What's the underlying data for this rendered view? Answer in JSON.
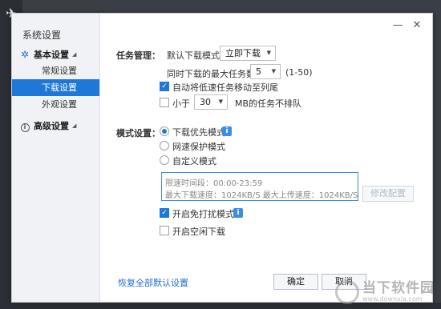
{
  "sidebar": {
    "title": "系统设置",
    "groups": [
      {
        "label": "基本设置",
        "icon": "gear-icon"
      },
      {
        "label": "高级设置",
        "icon": "info-circle-icon"
      }
    ],
    "items": [
      {
        "label": "常规设置",
        "active": false
      },
      {
        "label": "下载设置",
        "active": true
      },
      {
        "label": "外观设置",
        "active": false
      }
    ]
  },
  "window": {
    "minimize": "—",
    "close": "✕"
  },
  "task": {
    "section_label": "任务管理：",
    "default_mode_label": "默认下载模式为",
    "default_mode_value": "立即下载",
    "max_tasks_label": "同时下载的最大任务数",
    "max_tasks_value": "5",
    "max_tasks_range": "(1-50)",
    "auto_move_label": "自动将低速任务移动至列尾",
    "auto_move_checked": true,
    "less_than_label": "小于",
    "less_than_value": "30",
    "less_than_suffix": "MB的任务不排队",
    "less_than_checked": false
  },
  "mode": {
    "section_label": "模式设置：",
    "options": [
      {
        "label": "下载优先模式",
        "checked": true
      },
      {
        "label": "网速保护模式",
        "checked": false
      },
      {
        "label": "自定义模式",
        "checked": false
      }
    ],
    "custom_box": {
      "line1": "限速时间段：00:00-23:59",
      "line2": "最大下载速度：1024KB/S  最大上传速度：1024KB/S"
    },
    "modify_button": "修改配置",
    "no_disturb_label": "开启免打扰模式",
    "no_disturb_checked": true,
    "idle_download_label": "开启空闲下载",
    "idle_download_checked": false
  },
  "footer": {
    "restore_link": "恢复全部默认设置",
    "ok_button": "确定",
    "cancel_button": "取消"
  },
  "watermark": {
    "cn": "当下软件园",
    "en": "www.downxia.com"
  }
}
